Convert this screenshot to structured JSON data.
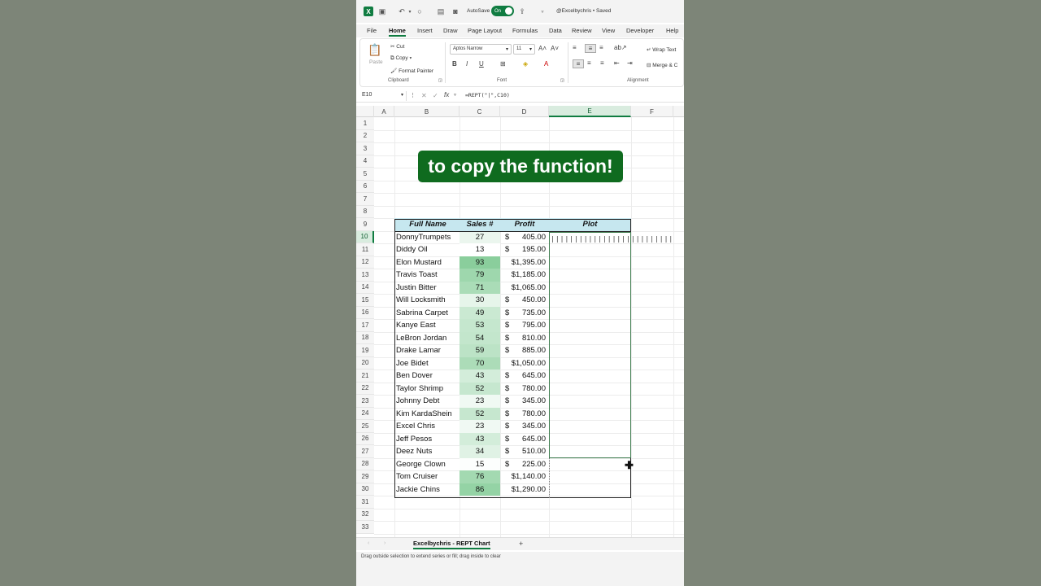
{
  "titlebar": {
    "autosave_label": "AutoSave",
    "autosave_state": "On",
    "doc_title": "@Excelbychris • Saved"
  },
  "menu": [
    "File",
    "Home",
    "Insert",
    "Draw",
    "Page Layout",
    "Formulas",
    "Data",
    "Review",
    "View",
    "Developer",
    "Help"
  ],
  "ribbon": {
    "paste": "Paste",
    "cut": "Cut",
    "copy": "Copy",
    "format_painter": "Format Painter",
    "clipboard": "Clipboard",
    "font_name": "Aptos Narrow",
    "font_size": "11",
    "font": "Font",
    "wrap_text": "Wrap Text",
    "merge": "Merge & C",
    "alignment": "Alignment"
  },
  "formula_bar": {
    "name_box": "E10",
    "formula": "=REPT(\"|\",C10)"
  },
  "columns": [
    "A",
    "B",
    "C",
    "D",
    "E",
    "F"
  ],
  "rows": [
    "1",
    "2",
    "3",
    "4",
    "5",
    "6",
    "7",
    "8",
    "9",
    "10",
    "11",
    "12",
    "13",
    "14",
    "15",
    "16",
    "17",
    "18",
    "19",
    "20",
    "21",
    "22",
    "23",
    "24",
    "25",
    "26",
    "27",
    "28",
    "29",
    "30",
    "31",
    "32",
    "33"
  ],
  "caption": "to copy the function!",
  "table": {
    "headers": {
      "name": "Full Name",
      "sales": "Sales #",
      "profit": "Profit",
      "plot": "Plot"
    },
    "rows": [
      {
        "name": "DonnyTrumpets",
        "sales": "27",
        "cur": "$",
        "profit": "405.00"
      },
      {
        "name": "Diddy Oil",
        "sales": "13",
        "cur": "$",
        "profit": "195.00"
      },
      {
        "name": "Elon Mustard",
        "sales": "93",
        "cur": "",
        "profit": "$1,395.00"
      },
      {
        "name": "Travis Toast",
        "sales": "79",
        "cur": "",
        "profit": "$1,185.00"
      },
      {
        "name": "Justin Bitter",
        "sales": "71",
        "cur": "",
        "profit": "$1,065.00"
      },
      {
        "name": "Will Locksmith",
        "sales": "30",
        "cur": "$",
        "profit": "450.00"
      },
      {
        "name": "Sabrina Carpet",
        "sales": "49",
        "cur": "$",
        "profit": "735.00"
      },
      {
        "name": "Kanye East",
        "sales": "53",
        "cur": "$",
        "profit": "795.00"
      },
      {
        "name": "LeBron Jordan",
        "sales": "54",
        "cur": "$",
        "profit": "810.00"
      },
      {
        "name": "Drake Lamar",
        "sales": "59",
        "cur": "$",
        "profit": "885.00"
      },
      {
        "name": "Joe Bidet",
        "sales": "70",
        "cur": "",
        "profit": "$1,050.00"
      },
      {
        "name": "Ben Dover",
        "sales": "43",
        "cur": "$",
        "profit": "645.00"
      },
      {
        "name": "Taylor Shrimp",
        "sales": "52",
        "cur": "$",
        "profit": "780.00"
      },
      {
        "name": "Johnny Debt",
        "sales": "23",
        "cur": "$",
        "profit": "345.00"
      },
      {
        "name": "Kim KardaShein",
        "sales": "52",
        "cur": "$",
        "profit": "780.00"
      },
      {
        "name": "Excel Chris",
        "sales": "23",
        "cur": "$",
        "profit": "345.00"
      },
      {
        "name": "Jeff Pesos",
        "sales": "43",
        "cur": "$",
        "profit": "645.00"
      },
      {
        "name": "Deez Nuts",
        "sales": "34",
        "cur": "$",
        "profit": "510.00"
      },
      {
        "name": "George Clown",
        "sales": "15",
        "cur": "$",
        "profit": "225.00"
      },
      {
        "name": "Tom Cruiser",
        "sales": "76",
        "cur": "",
        "profit": "$1,140.00"
      },
      {
        "name": "Jackie Chins",
        "sales": "86",
        "cur": "",
        "profit": "$1,290.00"
      }
    ]
  },
  "plot_value": "||||||||||||||||||||||||||",
  "colors": {
    "excel_green": "#107c41",
    "header_fill": "#c6e7ef",
    "caption_bg": "#0f6b1f",
    "scale_max": "#63be7b",
    "scale_min": "#ffffff"
  },
  "sheet_tab": "Excelbychris - REPT Chart",
  "status": "Drag outside selection to extend series or fill; drag inside to clear"
}
